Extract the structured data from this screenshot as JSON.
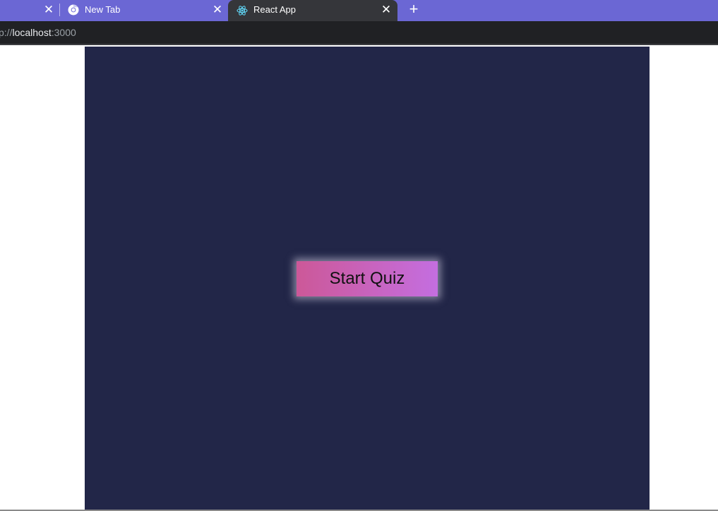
{
  "browser": {
    "tabs": [
      {
        "title": "",
        "close_icon": "✕"
      },
      {
        "title": "New Tab",
        "favicon": "chrome-icon",
        "close_icon": "✕"
      },
      {
        "title": "React App",
        "favicon": "react-icon",
        "close_icon": "✕",
        "active": true
      }
    ],
    "new_tab_icon": "+",
    "address": {
      "scheme": "p://",
      "host": "localhost",
      "port": ":3000"
    },
    "colors": {
      "tab_strip": "#6b67d4",
      "active_tab": "#35363a",
      "toolbar": "#202124"
    }
  },
  "app": {
    "background": "#222648",
    "start_button": {
      "label": "Start Quiz",
      "gradient_start": "#cc5898",
      "gradient_end": "#c46ee0"
    }
  }
}
